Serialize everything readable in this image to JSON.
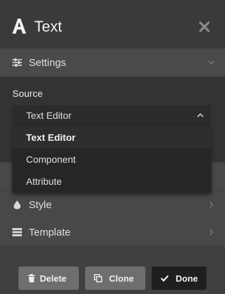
{
  "header": {
    "title": "Text",
    "title_icon": "text-format-icon",
    "close_icon": "close-icon"
  },
  "sections": {
    "settings": {
      "label": "Settings",
      "icon": "sliders-icon"
    },
    "style": {
      "label": "Style",
      "icon": "droplet-icon"
    },
    "template": {
      "label": "Template",
      "icon": "template-icon"
    }
  },
  "source": {
    "label": "Source",
    "selected": "Text Editor",
    "options": [
      "Text Editor",
      "Component",
      "Attribute"
    ]
  },
  "buttons": {
    "delete": "Delete",
    "clone": "Clone",
    "done": "Done"
  }
}
